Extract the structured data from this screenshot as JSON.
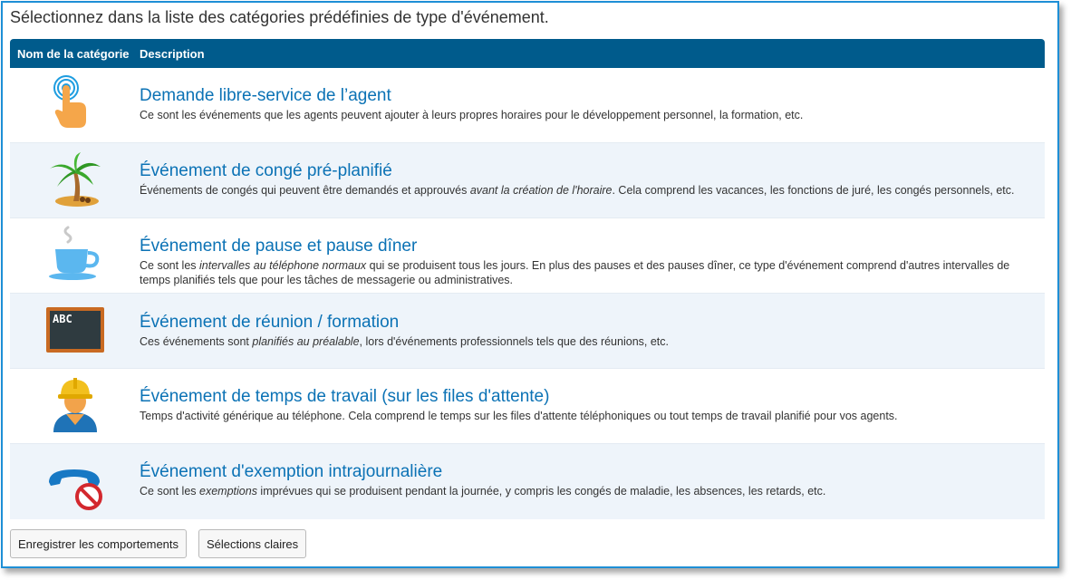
{
  "instruction": "Sélectionnez dans la liste des catégories prédéfinies de type d'événement.",
  "table": {
    "headers": {
      "name": "Nom de la catégorie",
      "description": "Description"
    }
  },
  "categories": [
    {
      "icon": "hand-touch-icon",
      "title": "Demande libre-service de l’agent",
      "desc": [
        "Ce sont les événements que les agents peuvent ajouter à leurs propres horaires pour le développement personnel, la formation, etc."
      ]
    },
    {
      "icon": "palm-tree-icon",
      "title": "Événement de congé pré-planifié",
      "desc": [
        "Événements de congés qui peuvent être demandés et approuvés ",
        "avant la création de l'horaire",
        ". Cela comprend les vacances, les fonctions de juré, les congés personnels, etc."
      ]
    },
    {
      "icon": "coffee-cup-icon",
      "title": "Événement de pause et pause dîner",
      "desc": [
        "Ce sont les ",
        "intervalles au téléphone normaux",
        " qui se produisent tous les jours. En plus des pauses et des pauses dîner, ce type d'événement comprend d'autres intervalles de temps planifiés tels que pour les tâches de messagerie ou administratives."
      ]
    },
    {
      "icon": "chalkboard-icon",
      "board_text": "ABC",
      "title": "Événement de réunion / formation",
      "desc": [
        "Ces événements sont ",
        "planifiés au préalable",
        ", lors d'événements professionnels tels que des réunions, etc."
      ]
    },
    {
      "icon": "worker-hardhat-icon",
      "title": "Événement de temps de travail (sur les files d'attente)",
      "desc": [
        "Temps d'activité générique au téléphone. Cela comprend le temps sur les files d'attente téléphoniques ou tout temps de travail planifié pour vos agents."
      ]
    },
    {
      "icon": "phone-prohibited-icon",
      "title": "Événement d'exemption intrajournalière",
      "desc": [
        "Ce sont les ",
        "exemptions",
        " imprévues qui se produisent pendant la journée, y compris les congés de maladie, les absences, les retards, etc."
      ]
    }
  ],
  "buttons": {
    "save": "Enregistrer les comportements",
    "clear": "Sélections claires"
  },
  "colors": {
    "header_bg": "#005b8c",
    "title_link": "#0b72b5",
    "alt_row": "#eef4fa",
    "frame_border": "#1e8fd6"
  }
}
